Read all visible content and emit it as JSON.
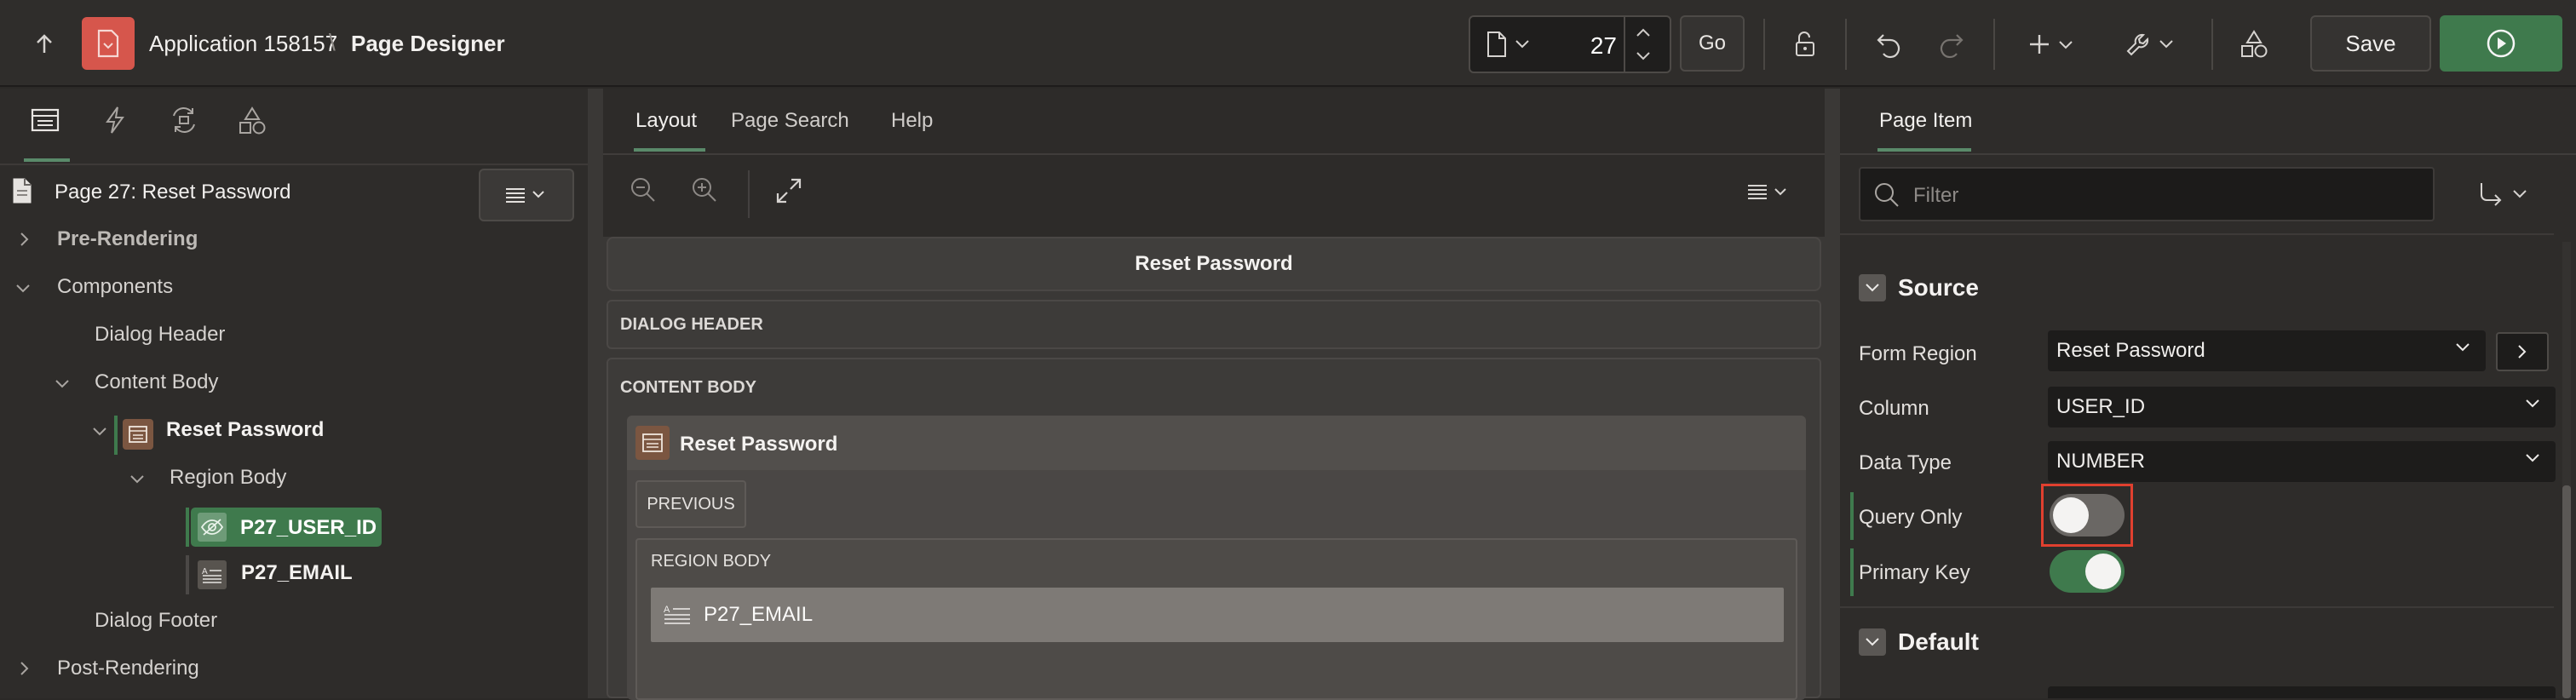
{
  "header": {
    "app_name": "Application 158157",
    "separator": "\\",
    "page_title": "Page Designer",
    "page_number": "27",
    "go_label": "Go",
    "save_label": "Save"
  },
  "left_panel": {
    "page_label": "Page 27: Reset Password",
    "tree": [
      {
        "label": "Pre-Rendering"
      },
      {
        "label": "Components"
      },
      {
        "label": "Dialog Header"
      },
      {
        "label": "Content Body"
      },
      {
        "label": "Reset Password"
      },
      {
        "label": "Region Body"
      },
      {
        "label": "P27_USER_ID"
      },
      {
        "label": "P27_EMAIL"
      },
      {
        "label": "Dialog Footer"
      },
      {
        "label": "Post-Rendering"
      }
    ]
  },
  "middle_panel": {
    "tabs": [
      "Layout",
      "Page Search",
      "Help"
    ],
    "dialog_title": "Reset Password",
    "dialog_header": "DIALOG HEADER",
    "content_body": "CONTENT BODY",
    "region_title": "Reset Password",
    "previous_button": "PREVIOUS",
    "region_body": "REGION BODY",
    "email_item": "P27_EMAIL"
  },
  "right_panel": {
    "tab": "Page Item",
    "filter_placeholder": "Filter",
    "source_section": "Source",
    "default_section": "Default",
    "props": {
      "form_region_label": "Form Region",
      "form_region_value": "Reset Password",
      "column_label": "Column",
      "column_value": "USER_ID",
      "data_type_label": "Data Type",
      "data_type_value": "NUMBER",
      "query_only_label": "Query Only",
      "query_only_on": false,
      "primary_key_label": "Primary Key",
      "primary_key_on": true
    }
  },
  "colors": {
    "run_button": "#3f7a4d",
    "selected_item": "#3f7a4d",
    "app_icon": "#d6564c",
    "highlight_box": "#e0402f",
    "active_tab_underline": "#5a8a6a"
  }
}
